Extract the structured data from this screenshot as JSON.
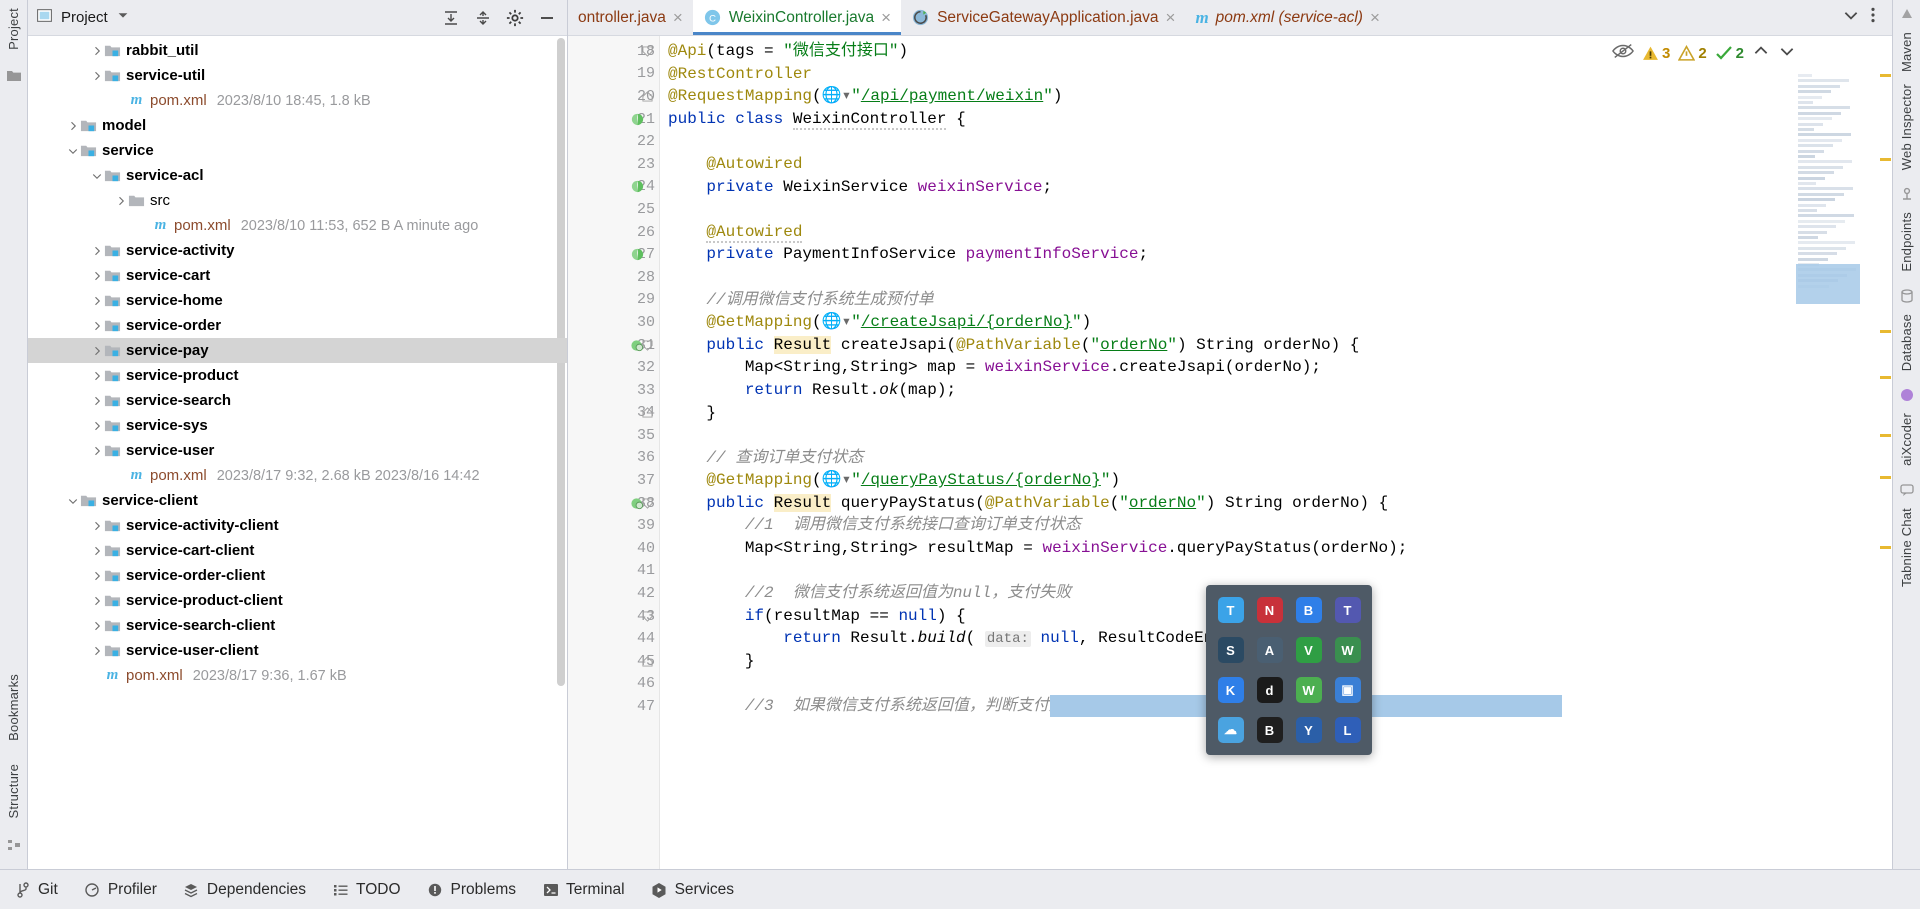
{
  "left_strip": {
    "tabs": [
      "Project",
      "Bookmarks",
      "Structure"
    ],
    "icons": [
      "folder-icon",
      "bookmark-icon",
      "structure-icon"
    ]
  },
  "right_strip": {
    "tabs": [
      "Maven",
      "Web Inspector",
      "Endpoints",
      "Database",
      "aiXcoder",
      "Tabnine Chat"
    ]
  },
  "project_panel": {
    "title": "Project",
    "dropdown_icon": "chevron-down-icon",
    "buttons": [
      "expand-all-icon",
      "collapse-all-icon",
      "settings-gear-icon",
      "hide-icon"
    ],
    "tree": [
      {
        "indent": 2,
        "arrow": "right",
        "icon": "module-folder",
        "label": "rabbit_util",
        "meta": ""
      },
      {
        "indent": 2,
        "arrow": "right",
        "icon": "module-folder",
        "label": "service-util",
        "meta": ""
      },
      {
        "indent": 3,
        "arrow": "none",
        "icon": "maven-m",
        "label": "pom.xml",
        "meta": "2023/8/10 18:45, 1.8 kB"
      },
      {
        "indent": 1,
        "arrow": "right",
        "icon": "module-folder",
        "label": "model",
        "meta": ""
      },
      {
        "indent": 1,
        "arrow": "down",
        "icon": "module-folder",
        "label": "service",
        "meta": ""
      },
      {
        "indent": 2,
        "arrow": "down",
        "icon": "module-folder",
        "label": "service-acl",
        "meta": ""
      },
      {
        "indent": 3,
        "arrow": "right",
        "icon": "plain-folder",
        "label": "src",
        "meta": "",
        "plain": true
      },
      {
        "indent": 4,
        "arrow": "none",
        "icon": "maven-m",
        "label": "pom.xml",
        "meta": "2023/8/10 11:53, 652 B A minute ago"
      },
      {
        "indent": 2,
        "arrow": "right",
        "icon": "module-folder",
        "label": "service-activity",
        "meta": ""
      },
      {
        "indent": 2,
        "arrow": "right",
        "icon": "module-folder",
        "label": "service-cart",
        "meta": ""
      },
      {
        "indent": 2,
        "arrow": "right",
        "icon": "module-folder",
        "label": "service-home",
        "meta": ""
      },
      {
        "indent": 2,
        "arrow": "right",
        "icon": "module-folder",
        "label": "service-order",
        "meta": ""
      },
      {
        "indent": 2,
        "arrow": "right",
        "icon": "module-folder",
        "label": "service-pay",
        "meta": "",
        "selected": true
      },
      {
        "indent": 2,
        "arrow": "right",
        "icon": "module-folder",
        "label": "service-product",
        "meta": ""
      },
      {
        "indent": 2,
        "arrow": "right",
        "icon": "module-folder",
        "label": "service-search",
        "meta": ""
      },
      {
        "indent": 2,
        "arrow": "right",
        "icon": "module-folder",
        "label": "service-sys",
        "meta": ""
      },
      {
        "indent": 2,
        "arrow": "right",
        "icon": "module-folder",
        "label": "service-user",
        "meta": ""
      },
      {
        "indent": 3,
        "arrow": "none",
        "icon": "maven-m",
        "label": "pom.xml",
        "meta": "2023/8/17 9:32, 2.68 kB 2023/8/16 14:42"
      },
      {
        "indent": 1,
        "arrow": "down",
        "icon": "module-folder",
        "label": "service-client",
        "meta": ""
      },
      {
        "indent": 2,
        "arrow": "right",
        "icon": "module-folder",
        "label": "service-activity-client",
        "meta": ""
      },
      {
        "indent": 2,
        "arrow": "right",
        "icon": "module-folder",
        "label": "service-cart-client",
        "meta": ""
      },
      {
        "indent": 2,
        "arrow": "right",
        "icon": "module-folder",
        "label": "service-order-client",
        "meta": ""
      },
      {
        "indent": 2,
        "arrow": "right",
        "icon": "module-folder",
        "label": "service-product-client",
        "meta": ""
      },
      {
        "indent": 2,
        "arrow": "right",
        "icon": "module-folder",
        "label": "service-search-client",
        "meta": ""
      },
      {
        "indent": 2,
        "arrow": "right",
        "icon": "module-folder",
        "label": "service-user-client",
        "meta": ""
      },
      {
        "indent": 2,
        "arrow": "none",
        "icon": "maven-m",
        "label": "pom.xml",
        "meta": "2023/8/17 9:36, 1.67 kB"
      }
    ]
  },
  "editor": {
    "tabs": [
      {
        "label": "ontroller.java",
        "icon": "java-class-icon",
        "active": false,
        "truncated": true
      },
      {
        "label": "WeixinController.java",
        "icon": "java-class-icon",
        "active": true
      },
      {
        "label": "ServiceGatewayApplication.java",
        "icon": "spring-boot-icon",
        "active": false
      },
      {
        "label": "pom.xml (service-acl)",
        "icon": "maven-m",
        "active": false,
        "italic": true
      }
    ],
    "tabbar_buttons": [
      "chevron-down-icon",
      "more-vertical-icon"
    ],
    "inspections": {
      "eye_icon": "hide-inspections-icon",
      "warnings": "3",
      "weak_warnings": "2",
      "ok": "2",
      "up_icon": "chevron-up-icon",
      "down_icon": "chevron-down-icon"
    },
    "first_line_number": 18,
    "lines": [
      {
        "n": 18,
        "fold": "start",
        "html": "<span class=\"ann\">@Api</span>(tags = <span class=\"str\">\"微信支付接口\"</span>)"
      },
      {
        "n": 19,
        "html": "<span class=\"ann\">@RestController</span>"
      },
      {
        "n": 20,
        "fold": "end",
        "html": "<span class=\"ann\">@RequestMapping</span>(<span class=\"gicon\">🌐</span><span class=\"str\">\"</span><span class=\"lnk\">/api/payment/weixin</span><span class=\"str\">\"</span>)"
      },
      {
        "n": 21,
        "mark": "bean-icon",
        "html": "<span class=\"kw\">public</span> <span class=\"kw\">class</span> <span class=\"cls warnsquig\">WeixinController</span> {"
      },
      {
        "n": 22,
        "html": ""
      },
      {
        "n": 23,
        "html": "    <span class=\"ann\">@Autowired</span>"
      },
      {
        "n": 24,
        "mark": "bean-icon",
        "html": "    <span class=\"kw\">private</span> WeixinService <span class=\"fld\">weixinService</span>;"
      },
      {
        "n": 25,
        "html": ""
      },
      {
        "n": 26,
        "html": "    <span class=\"ann warnsquig\">@Autowired</span>"
      },
      {
        "n": 27,
        "mark": "bean-icon",
        "html": "    <span class=\"kw\">private</span> PaymentInfoService <span class=\"fld\">paymentInfoService</span>;"
      },
      {
        "n": 28,
        "html": ""
      },
      {
        "n": 29,
        "html": "    <span class=\"cmt\">//调用微信支付系统生成预付单</span>"
      },
      {
        "n": 30,
        "html": "    <span class=\"ann\">@GetMapping</span>(<span class=\"gicon\">🌐</span><span class=\"str\">\"</span><span class=\"lnk\">/createJsapi/{orderNo}</span><span class=\"str\">\"</span>)"
      },
      {
        "n": 31,
        "mark": "endpoint-icon",
        "fold": "start",
        "html": "    <span class=\"kw\">public</span> <span class=\"hl\">Result</span> createJsapi(<span class=\"ann\">@PathVariable</span>(<span class=\"str\">\"</span><span class=\"lnk\">orderNo</span><span class=\"str\">\"</span>) String orderNo) {"
      },
      {
        "n": 32,
        "html": "        Map&lt;String,String&gt; map = <span class=\"fld\">weixinService</span>.createJsapi(orderNo);"
      },
      {
        "n": 33,
        "html": "        <span class=\"kw\">return</span> Result.<span class=\"italicv\">ok</span>(map);"
      },
      {
        "n": 34,
        "fold": "end",
        "html": "    }"
      },
      {
        "n": 35,
        "html": ""
      },
      {
        "n": 36,
        "html": "    <span class=\"cmt\">// 查询订单支付状态</span>"
      },
      {
        "n": 37,
        "html": "    <span class=\"ann\">@GetMapping</span>(<span class=\"gicon\">🌐</span><span class=\"str\">\"</span><span class=\"lnk\">/queryPayStatus/{orderNo}</span><span class=\"str\">\"</span>)"
      },
      {
        "n": 38,
        "mark": "endpoint-icon",
        "fold": "start",
        "html": "    <span class=\"kw\">public</span> <span class=\"hl\">Result</span> queryPayStatus(<span class=\"ann\">@PathVariable</span>(<span class=\"str\">\"</span><span class=\"lnk\">orderNo</span><span class=\"str\">\"</span>) String orderNo) {"
      },
      {
        "n": 39,
        "html": "        <span class=\"cmt\">//1  调用微信支付系统接口查询订单支付状态</span>"
      },
      {
        "n": 40,
        "html": "        Map&lt;String,String&gt; resultMap = <span class=\"fld\">weixinService</span>.queryPayStatus(orderNo);"
      },
      {
        "n": 41,
        "html": ""
      },
      {
        "n": 42,
        "html": "        <span class=\"cmt\">//2  微信支付系统返回值为null，支付失败</span>"
      },
      {
        "n": 43,
        "fold": "start",
        "html": "        <span class=\"kw\">if</span>(resultMap == <span class=\"kw\">null</span>) {"
      },
      {
        "n": 44,
        "html": "            <span class=\"kw\">return</span> Result.<span class=\"italicv\">build</span>( <span class=\"param-hint\">data:</span> <span class=\"kw\">null</span>, ResultCodeEnum.<span class=\"fld italicv\">PAYMENT_FAI</span>"
      },
      {
        "n": 45,
        "fold": "end",
        "html": "        }"
      },
      {
        "n": 46,
        "html": ""
      },
      {
        "n": 47,
        "html": "        <span class=\"cmt\">//3  如果微信支付系统返回值，判断支付成功</span>"
      }
    ]
  },
  "statusbar": {
    "items": [
      {
        "label": "Git",
        "icon": "git-branch-icon"
      },
      {
        "label": "Profiler",
        "icon": "profiler-icon"
      },
      {
        "label": "Dependencies",
        "icon": "dependencies-icon"
      },
      {
        "label": "TODO",
        "icon": "todo-list-icon"
      },
      {
        "label": "Problems",
        "icon": "problems-icon"
      },
      {
        "label": "Terminal",
        "icon": "terminal-icon"
      },
      {
        "label": "Services",
        "icon": "services-play-icon"
      }
    ]
  },
  "popup": {
    "name": "app-launcher-popup",
    "icons": [
      {
        "name": "tim-icon",
        "glyph": "T",
        "color": "#3ba3e8"
      },
      {
        "name": "netease-icon",
        "glyph": "N",
        "color": "#c8313a"
      },
      {
        "name": "bluetooth-icon",
        "glyph": "B",
        "color": "#2f7fe8"
      },
      {
        "name": "teams-icon",
        "glyph": "T",
        "color": "#5358b0"
      },
      {
        "name": "steam-icon",
        "glyph": "S",
        "color": "#2b4a63"
      },
      {
        "name": "apps-icon",
        "glyph": "A",
        "color": "#4a5f72"
      },
      {
        "name": "shield-icon",
        "glyph": "V",
        "color": "#2f9e44"
      },
      {
        "name": "wechat-work-icon",
        "glyph": "W",
        "color": "#3a8f4f"
      },
      {
        "name": "kingsoft-icon",
        "glyph": "K",
        "color": "#2f7fe8"
      },
      {
        "name": "tiktok-icon",
        "glyph": "d",
        "color": "#1b1b1b"
      },
      {
        "name": "wechat-icon",
        "glyph": "W",
        "color": "#4caf50"
      },
      {
        "name": "window-icon",
        "glyph": "▣",
        "color": "#3a7fd5"
      },
      {
        "name": "cloud-icon",
        "glyph": "☁",
        "color": "#4aa3e0"
      },
      {
        "name": "bilibili-icon",
        "glyph": "B",
        "color": "#1f1f1f"
      },
      {
        "name": "yy-icon",
        "glyph": "Y",
        "color": "#2b5fa8"
      },
      {
        "name": "line-icon",
        "glyph": "L",
        "color": "#2f5fb8"
      }
    ]
  },
  "colors": {
    "chrome": "#ebecf0",
    "accent": "#4a86c8",
    "selection": "#a6c9e8",
    "tree_selected": "#d4d4d4",
    "keyword": "#0033b3",
    "string": "#067d17",
    "annotation": "#9e880d",
    "comment": "#8c8c8c",
    "field": "#871094"
  }
}
